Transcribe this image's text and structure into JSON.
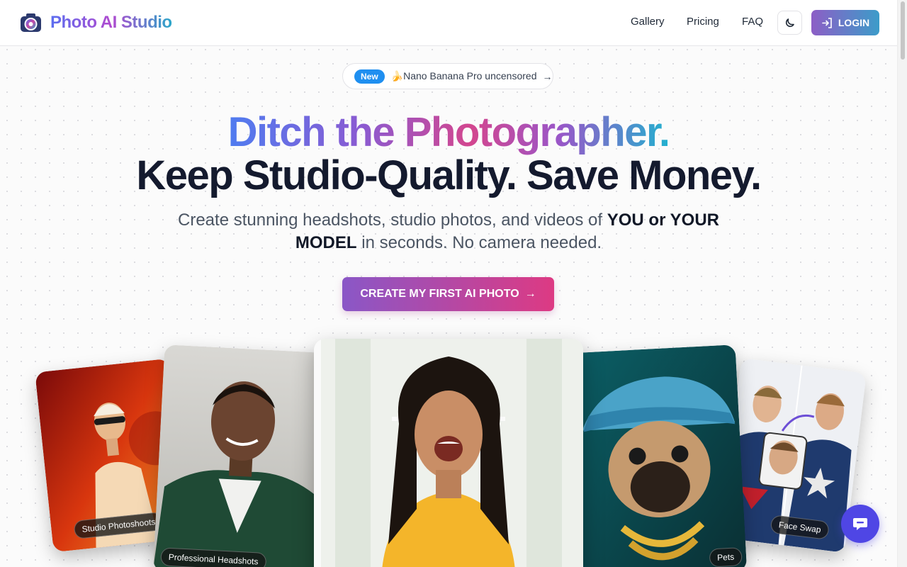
{
  "header": {
    "brand": "Photo AI Studio",
    "nav": [
      "Gallery",
      "Pricing",
      "FAQ"
    ],
    "login_label": "LOGIN"
  },
  "announcement": {
    "badge": "New",
    "text": "🍌Nano Banana Pro uncensored",
    "arrow": "→"
  },
  "hero": {
    "headline_line1": [
      "Ditch the Photographer."
    ],
    "headline_line2": "Keep Studio-Quality. Save Money.",
    "subtitle_pre": "Create stunning headshots, studio photos, and videos of ",
    "subtitle_bold": "YOU or YOUR MODEL",
    "subtitle_post": " in seconds. No camera needed.",
    "cta_label": "CREATE MY FIRST AI PHOTO",
    "cta_arrow": "→"
  },
  "cards": {
    "studio": "Studio Photoshoots",
    "headshots": "Professional Headshots",
    "pets": "Pets",
    "faceswap": "Face Swap"
  },
  "colors": {
    "accent_purple": "#8a57c7",
    "accent_pink": "#dd3a83",
    "accent_blue": "#1f8ff0",
    "chat": "#4f46e5"
  },
  "icons": [
    "camera-logo-icon",
    "moon-icon",
    "login-icon",
    "arrow-right-icon",
    "chat-icon"
  ]
}
